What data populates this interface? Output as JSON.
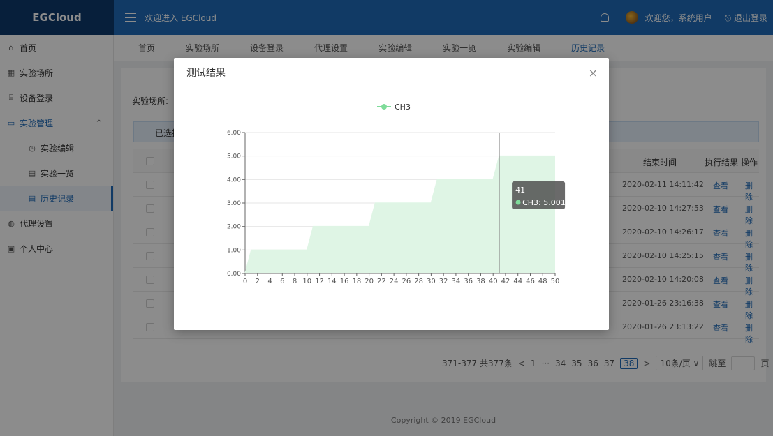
{
  "app": {
    "brand": "EGCloud",
    "welcome": "欢迎进入 EGCloud"
  },
  "header": {
    "user_greeting": "欢迎您，系统用户",
    "logout": "退出登录"
  },
  "sidebar": {
    "items": [
      {
        "label": "首页",
        "icon": "home-icon"
      },
      {
        "label": "实验场所",
        "icon": "grid-icon"
      },
      {
        "label": "设备登录",
        "icon": "device-icon"
      },
      {
        "label": "实验管理",
        "icon": "monitor-icon"
      },
      {
        "label": "实验编辑",
        "icon": "clock-icon"
      },
      {
        "label": "实验一览",
        "icon": "table-icon"
      },
      {
        "label": "历史记录",
        "icon": "history-icon"
      },
      {
        "label": "代理设置",
        "icon": "globe-icon"
      },
      {
        "label": "个人中心",
        "icon": "id-card-icon"
      }
    ]
  },
  "tabs": [
    "首页",
    "实验场所",
    "设备登录",
    "代理设置",
    "实验编辑",
    "实验一览",
    "实验编辑",
    "历史记录"
  ],
  "filters": {
    "place_label": "实验场所:",
    "selected_label": "已选择"
  },
  "table": {
    "headers": {
      "end_time": "结束时间",
      "result": "执行结果",
      "action": "操作"
    },
    "rows": [
      {
        "end_time": "2020-02-11 14:11:42",
        "view": "查看",
        "delete": "删除"
      },
      {
        "end_time": "2020-02-10 14:27:53",
        "view": "查看",
        "delete": "删除"
      },
      {
        "end_time": "2020-02-10 14:26:17",
        "view": "查看",
        "delete": "删除"
      },
      {
        "end_time": "2020-02-10 14:25:15",
        "view": "查看",
        "delete": "删除"
      },
      {
        "end_time": "2020-02-10 14:20:08",
        "view": "查看",
        "delete": "删除"
      },
      {
        "end_time": "2020-01-26 23:16:38",
        "view": "查看",
        "delete": "删除"
      },
      {
        "end_time": "2020-01-26 23:13:22",
        "view": "查看",
        "delete": "删除"
      }
    ]
  },
  "pagination": {
    "range": "371-377 共377条",
    "prev": "<",
    "first": "1",
    "ellipsis": "···",
    "pages": [
      "34",
      "35",
      "36",
      "37"
    ],
    "current": "38",
    "next": ">",
    "page_size": "10条/页",
    "jump_label": "跳至",
    "page_suffix": "页"
  },
  "footer": {
    "copyright": "Copyright © 2019 EGCloud"
  },
  "modal": {
    "title": "测试结果",
    "close": "×"
  },
  "colors": {
    "primary": "#1f6bb8",
    "brand_dark": "#0e3a6c",
    "series": "#7fdc9a",
    "area": "#dff5e5"
  },
  "chart_data": {
    "type": "area",
    "legend": [
      "CH3"
    ],
    "legend_position": "top-center",
    "ylim": [
      0,
      6
    ],
    "xlim": [
      0,
      50
    ],
    "y_ticks": [
      "0.00",
      "1.00",
      "2.00",
      "3.00",
      "4.00",
      "5.00",
      "6.00"
    ],
    "x_ticks": [
      "0",
      "2",
      "4",
      "6",
      "8",
      "10",
      "12",
      "14",
      "16",
      "18",
      "20",
      "22",
      "24",
      "26",
      "28",
      "30",
      "32",
      "34",
      "36",
      "38",
      "40",
      "42",
      "44",
      "46",
      "48",
      "50"
    ],
    "grid": true,
    "series": [
      {
        "name": "CH3",
        "x": [
          0,
          1,
          10,
          11,
          20,
          21,
          30,
          31,
          40,
          41,
          50
        ],
        "y": [
          0,
          1,
          1,
          2,
          2,
          3,
          3,
          4,
          4,
          5.001,
          5.001
        ]
      }
    ],
    "tooltip": {
      "x": "41",
      "text": "CH3: 5.001"
    }
  }
}
